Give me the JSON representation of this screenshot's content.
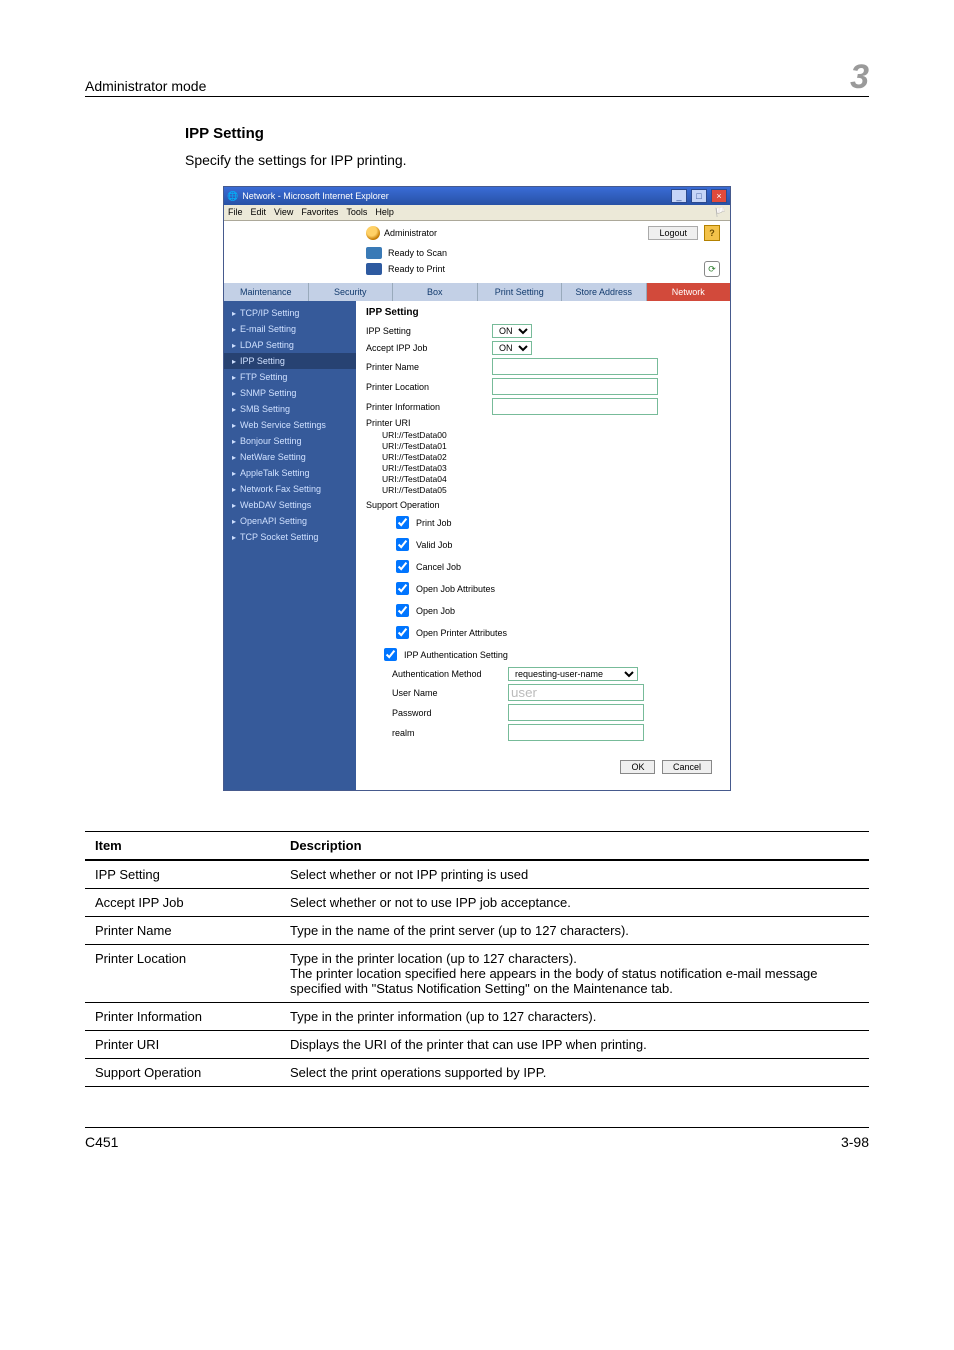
{
  "runhead": {
    "left": "Administrator mode",
    "right": "3"
  },
  "section": {
    "title": "IPP Setting",
    "desc": "Specify the settings for IPP printing."
  },
  "ie": {
    "title": "Network - Microsoft Internet Explorer",
    "menus": [
      "File",
      "Edit",
      "View",
      "Favorites",
      "Tools",
      "Help"
    ],
    "user_label": "Administrator",
    "logout": "Logout",
    "ready_scan": "Ready to Scan",
    "ready_print": "Ready to Print",
    "tabs": [
      "Maintenance",
      "Security",
      "Box",
      "Print Setting",
      "Store Address",
      "Network"
    ],
    "side_items": [
      "TCP/IP Setting",
      "E-mail Setting",
      "LDAP Setting",
      "IPP Setting",
      "FTP Setting",
      "SNMP Setting",
      "SMB Setting",
      "Web Service Settings",
      "Bonjour Setting",
      "NetWare Setting",
      "AppleTalk Setting",
      "Network Fax Setting",
      "WebDAV Settings",
      "OpenAPI Setting",
      "TCP Socket Setting"
    ],
    "panel_title": "IPP Setting",
    "rows": {
      "ipp_setting": "IPP Setting",
      "accept_ipp": "Accept IPP Job",
      "printer_name": "Printer Name",
      "printer_location": "Printer Location",
      "printer_info": "Printer Information",
      "printer_uri_label": "Printer URI",
      "support_op": "Support Operation",
      "ipp_auth": "IPP Authentication Setting",
      "auth_method": "Authentication Method",
      "user_name": "User Name",
      "password": "Password",
      "realm": "realm"
    },
    "on_opt": "ON",
    "auth_method_val": "requesting-user-name",
    "user_name_val": "user",
    "ops": [
      "Print Job",
      "Valid Job",
      "Cancel Job",
      "Open Job Attributes",
      "Open Job",
      "Open Printer Attributes"
    ],
    "uris": [
      "URI://TestData00",
      "URI://TestData01",
      "URI://TestData02",
      "URI://TestData03",
      "URI://TestData04",
      "URI://TestData05"
    ],
    "ok": "OK",
    "cancel": "Cancel"
  },
  "table": {
    "head_item": "Item",
    "head_desc": "Description",
    "rows": [
      {
        "item": "IPP Setting",
        "desc": "Select whether or not IPP printing is used"
      },
      {
        "item": "Accept IPP Job",
        "desc": "Select whether or not to use IPP job acceptance."
      },
      {
        "item": "Printer Name",
        "desc": "Type in the name of the print server (up to 127 characters)."
      },
      {
        "item": "Printer Location",
        "desc": "Type in the printer location (up to 127 characters).\nThe printer location specified here appears in the body of status notification e-mail message specified with \"Status Notification Setting\" on the Maintenance tab."
      },
      {
        "item": "Printer Information",
        "desc": "Type in the printer information (up to 127 characters)."
      },
      {
        "item": "Printer URI",
        "desc": "Displays the URI of the printer that can use IPP when printing."
      },
      {
        "item": "Support Operation",
        "desc": "Select the print operations supported by IPP."
      }
    ]
  },
  "footer": {
    "left": "C451",
    "right": "3-98"
  }
}
